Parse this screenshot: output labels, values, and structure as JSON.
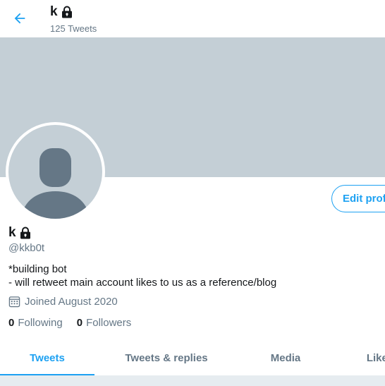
{
  "header": {
    "back_icon": "arrow-left-icon",
    "name": "k",
    "name_icon": "lock-icon",
    "tweet_count": "125 Tweets"
  },
  "banner": {
    "color": "#c4cfd6"
  },
  "avatar": {
    "icon": "default-avatar-icon"
  },
  "edit_button": {
    "label": "Edit profile"
  },
  "profile": {
    "name": "k",
    "name_icon": "lock-icon",
    "handle": "@kkb0t",
    "bio_lines": [
      "*building bot",
      "- will retweet main account likes to us as a reference/blog"
    ],
    "joined_icon": "calendar-icon",
    "joined": "Joined August 2020",
    "following_count": "0",
    "following_label": "Following",
    "followers_count": "0",
    "followers_label": "Followers"
  },
  "tabs": [
    {
      "label": "Tweets",
      "active": true
    },
    {
      "label": "Tweets & replies",
      "active": false
    },
    {
      "label": "Media",
      "active": false
    },
    {
      "label": "Likes",
      "active": false
    }
  ],
  "colors": {
    "accent": "#1da1f2",
    "text": "#14171a",
    "secondary_text": "#657786",
    "banner": "#c4cfd6"
  }
}
